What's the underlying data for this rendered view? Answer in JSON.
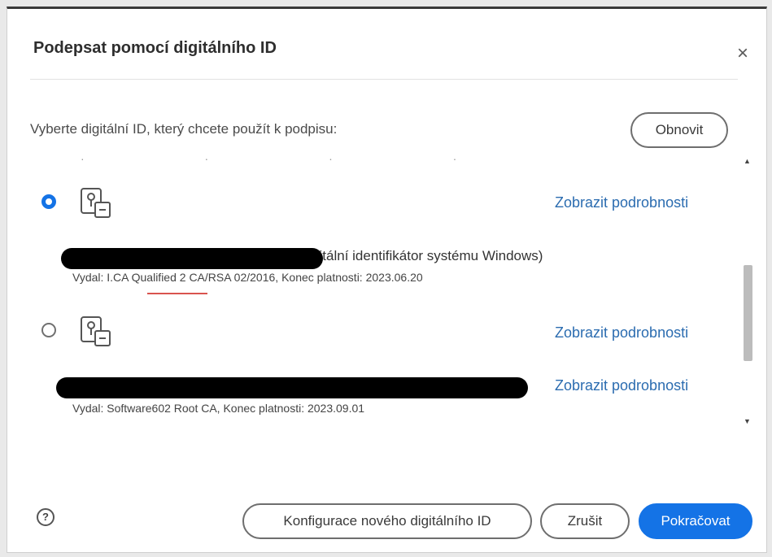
{
  "dialog": {
    "title": "Podepsat pomocí digitálního ID",
    "close_glyph": "×",
    "instruction": "Vyberte digitální ID, který chcete použít k podpisu:",
    "refresh_label": "Obnovit"
  },
  "ids": [
    {
      "selected": true,
      "icon": "digital-id-icon",
      "details_label": "Zobrazit podrobnosti",
      "name_visible": "Digitální identifikátor systému Windows)",
      "issuer": "Vydal: I.CA Qualified 2 CA/RSA 02/2016, Konec platnosti: 2023.06.20"
    },
    {
      "selected": false,
      "icon": "digital-id-icon",
      "details_label": "Zobrazit podrobnosti",
      "details_label_2": "Zobrazit podrobnosti",
      "issuer": "Vydal: Software602 Root CA, Konec platnosti: 2023.09.01"
    }
  ],
  "footer": {
    "help_glyph": "?",
    "config_label": "Konfigurace nového digitálního ID",
    "cancel_label": "Zrušit",
    "continue_label": "Pokračovat"
  },
  "colors": {
    "accent": "#1473e6",
    "link": "#2b6cb0",
    "redaction": "#000000"
  }
}
